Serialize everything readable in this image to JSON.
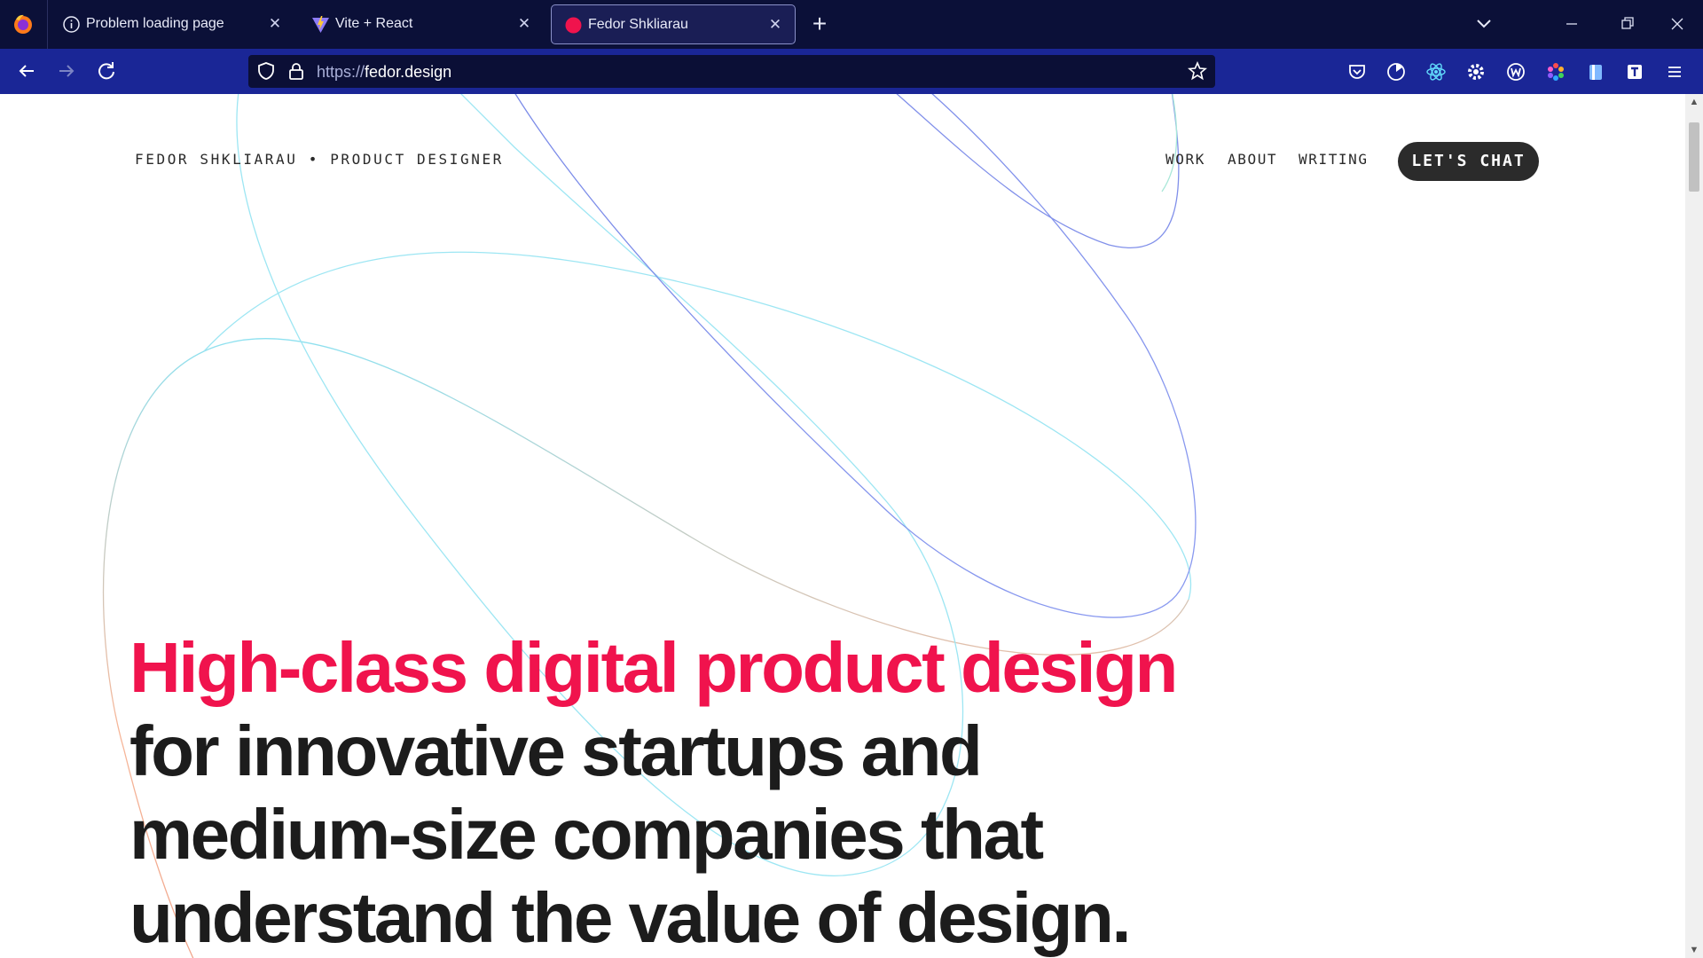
{
  "browser": {
    "tabs": [
      {
        "title": "Problem loading page",
        "icon": "info-icon",
        "active": false
      },
      {
        "title": "Vite + React",
        "icon": "vite-logo-icon",
        "active": false
      },
      {
        "title": "Fedor Shkliarau",
        "icon": "red-dot-favicon",
        "active": true
      }
    ],
    "new_tab_label": "+",
    "url_scheme": "https://",
    "url_host": "fedor.design",
    "extensions": [
      "pocket-icon",
      "timer-icon",
      "react-devtools-icon",
      "settings-gear-icon",
      "wappalyzer-icon",
      "color-picker-icon",
      "reader-icon",
      "bookmark-t-icon",
      "menu-icon"
    ],
    "colors": {
      "tabbar": "#0b1038",
      "navbar": "#1a2696",
      "urlbar": "#0b0f36"
    }
  },
  "site": {
    "brand": "FEDOR SHKLIARAU • PRODUCT DESIGNER",
    "nav": {
      "work": "WORK",
      "about": "ABOUT",
      "writing": "WRITING"
    },
    "cta_label": "LET'S CHAT",
    "hero": {
      "accent_line": "High-class digital product design",
      "line2": "for innovative startups and",
      "line3": "medium-size companies that",
      "line4": "understand the value of design."
    },
    "colors": {
      "accent": "#f0134d",
      "text": "#1c1c1c",
      "cta_bg": "#2b2b2b"
    }
  }
}
